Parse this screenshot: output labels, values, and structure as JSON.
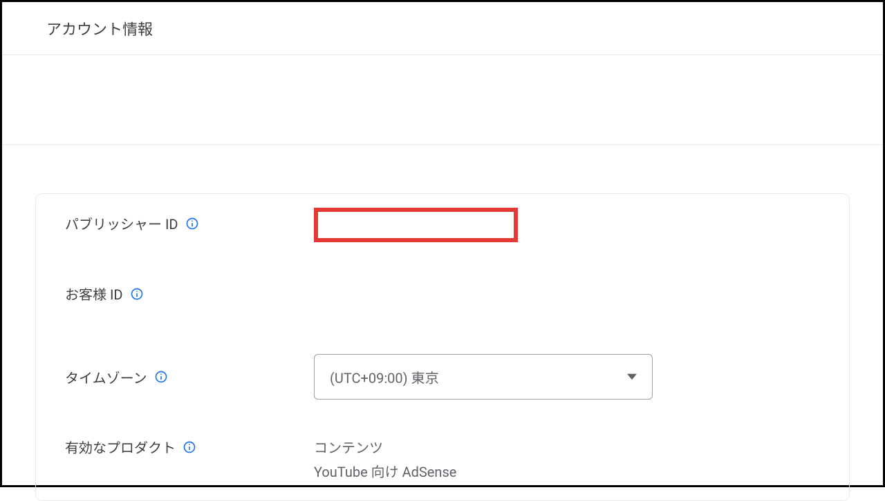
{
  "header": {
    "title": "アカウント情報"
  },
  "fields": {
    "publisherId": {
      "label": "パブリッシャー ID"
    },
    "customerId": {
      "label": "お客様 ID"
    },
    "timezone": {
      "label": "タイムゾーン",
      "value": "(UTC+09:00) 東京"
    },
    "activeProducts": {
      "label": "有効なプロダクト",
      "values": [
        "コンテンツ",
        "YouTube 向け AdSense"
      ]
    }
  }
}
